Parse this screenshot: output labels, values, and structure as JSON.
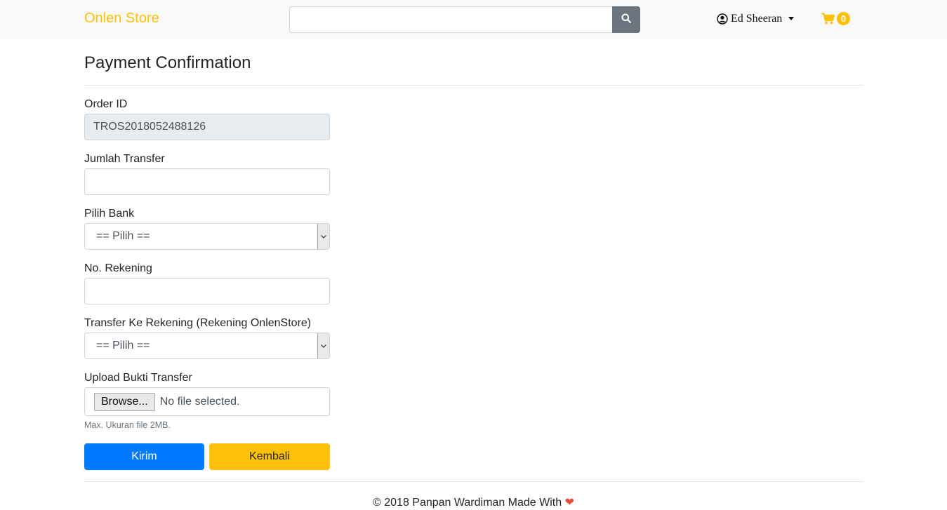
{
  "navbar": {
    "brand": "Onlen Store",
    "search": {
      "value": "",
      "placeholder": ""
    },
    "user_name": "Ed Sheeran",
    "cart_count": "0"
  },
  "page": {
    "title": "Payment Confirmation"
  },
  "form": {
    "order_id": {
      "label": "Order ID",
      "value": "TROS2018052488126"
    },
    "jumlah_transfer": {
      "label": "Jumlah Transfer",
      "value": ""
    },
    "pilih_bank": {
      "label": "Pilih Bank",
      "selected": "== Pilih =="
    },
    "no_rekening": {
      "label": "No. Rekening",
      "value": ""
    },
    "transfer_ke": {
      "label": "Transfer Ke Rekening (Rekening OnlenStore)",
      "selected": "== Pilih =="
    },
    "upload": {
      "label": "Upload Bukti Transfer",
      "browse_label": "Browse...",
      "status": "No file selected.",
      "help": "Max. Ukuran file 2MB."
    },
    "submit_label": "Kirim",
    "back_label": "Kembali"
  },
  "footer": {
    "text": "© 2018 Panpan Wardiman Made With",
    "heart": "❤"
  },
  "colors": {
    "brand": "#ffc107",
    "primary": "#007bff",
    "warning": "#ffc107",
    "heart": "#e74c3c"
  }
}
